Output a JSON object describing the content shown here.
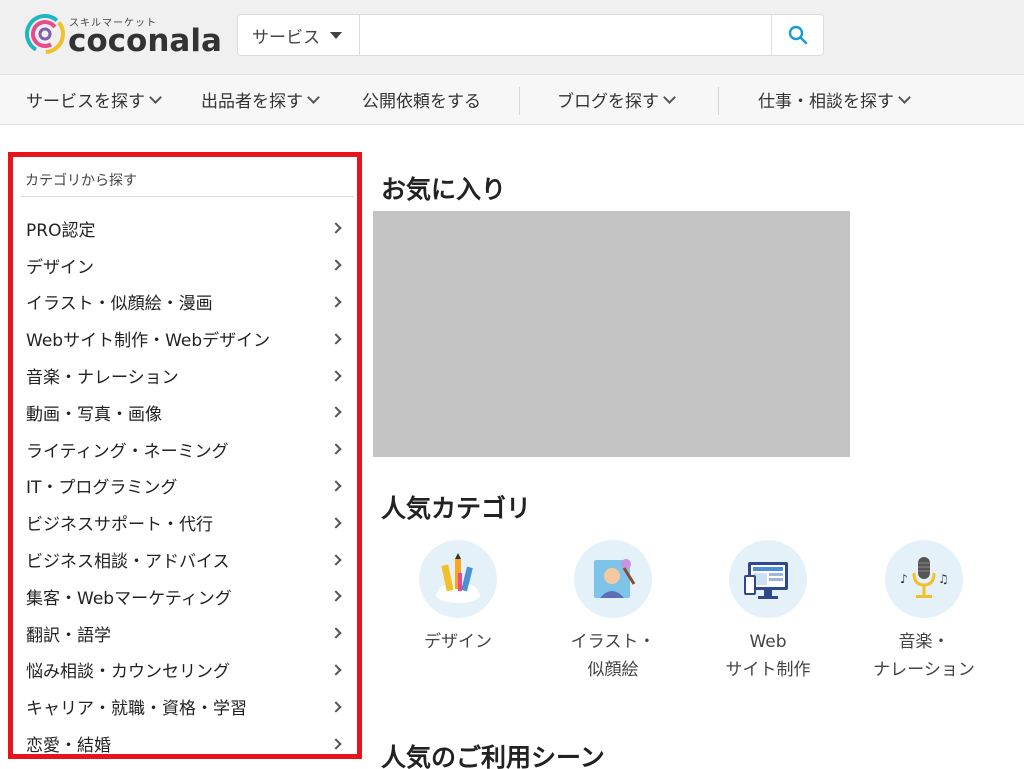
{
  "header": {
    "logo_sub": "スキルマーケット",
    "logo_text": "coconala",
    "search": {
      "select_value": "サービス",
      "input_value": "",
      "placeholder": ""
    }
  },
  "nav": {
    "items": [
      {
        "label": "サービスを探す",
        "icon": "chevron-down-icon"
      },
      {
        "label": "出品者を探す",
        "icon": "chevron-down-icon"
      },
      {
        "label": "公開依頼をする"
      },
      {
        "label": "ブログを探す",
        "icon": "chevron-down-icon"
      },
      {
        "label": "仕事・相談を探す",
        "icon": "chevron-down-icon"
      }
    ]
  },
  "sidebar": {
    "title": "カテゴリから探す",
    "items": [
      {
        "label": "PRO認定"
      },
      {
        "label": "デザイン"
      },
      {
        "label": "イラスト・似顔絵・漫画"
      },
      {
        "label": "Webサイト制作・Webデザイン"
      },
      {
        "label": "音楽・ナレーション"
      },
      {
        "label": "動画・写真・画像"
      },
      {
        "label": "ライティング・ネーミング"
      },
      {
        "label": "IT・プログラミング"
      },
      {
        "label": "ビジネスサポート・代行"
      },
      {
        "label": "ビジネス相談・アドバイス"
      },
      {
        "label": "集客・Webマーケティング"
      },
      {
        "label": "翻訳・語学"
      },
      {
        "label": "悩み相談・カウンセリング"
      },
      {
        "label": "キャリア・就職・資格・学習"
      },
      {
        "label": "恋愛・結婚"
      }
    ]
  },
  "main": {
    "favorites_title": "お気に入り",
    "popular_title": "人気カテゴリ",
    "popular_categories": [
      {
        "label": "デザイン",
        "icon": "design-tools-icon"
      },
      {
        "label": "イラスト・\n似顔絵",
        "icon": "portrait-illustration-icon"
      },
      {
        "label": "Web\nサイト制作",
        "icon": "web-monitor-icon"
      },
      {
        "label": "音楽・\nナレーション",
        "icon": "microphone-icon"
      }
    ],
    "scenes_title": "人気のご利用シーン"
  },
  "colors": {
    "highlight_border": "#e8141c",
    "search_icon": "#1a9bd7",
    "category_circle": "#e4f1f8"
  }
}
